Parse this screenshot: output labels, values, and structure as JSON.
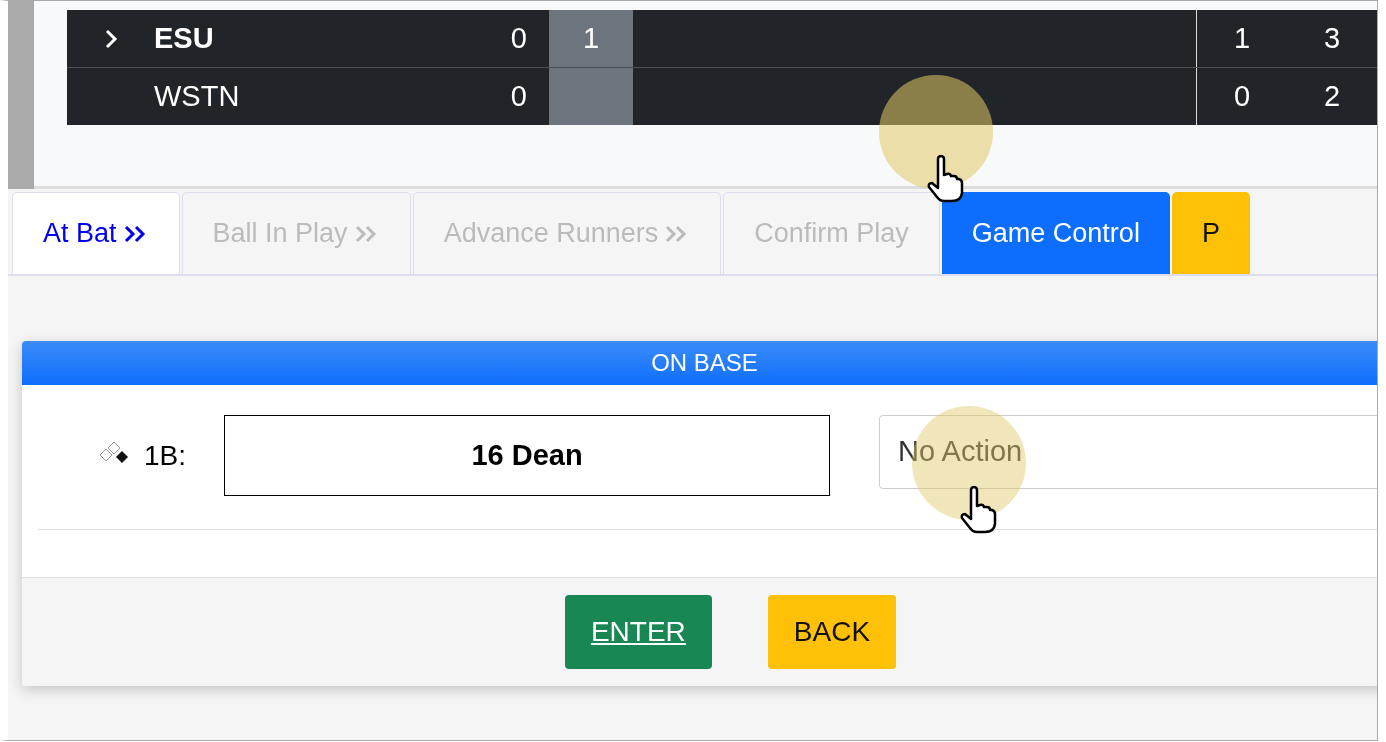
{
  "scoreboard": {
    "innings": [
      {
        "selected": false
      },
      {
        "selected": true
      }
    ],
    "rows": [
      {
        "team": "ESU",
        "at_bat": true,
        "scores": [
          "0",
          "1"
        ],
        "runs": "1",
        "hits": "3"
      },
      {
        "team": "WSTN",
        "at_bat": false,
        "scores": [
          "0"
        ],
        "runs": "0",
        "hits": "2"
      }
    ]
  },
  "tabs": [
    {
      "label": "At Bat",
      "kind": "step",
      "selected": true,
      "chevron": true
    },
    {
      "label": "Ball In Play",
      "kind": "step",
      "selected": false,
      "chevron": true
    },
    {
      "label": "Advance Runners",
      "kind": "step",
      "selected": false,
      "chevron": true
    },
    {
      "label": "Confirm Play",
      "kind": "step",
      "selected": false,
      "chevron": false
    },
    {
      "label": "Game Control",
      "kind": "button",
      "color": "#0d6efd"
    },
    {
      "label": "P",
      "kind": "button",
      "color": "#ffc107"
    }
  ],
  "on_base": {
    "title": "ON BASE",
    "runners": [
      {
        "base": "1B:",
        "player": "16 Dean",
        "action": "No Action"
      }
    ]
  },
  "buttons": [
    {
      "label": "ENTER",
      "color": "#198754"
    },
    {
      "label": "BACK",
      "color": "#ffc107"
    }
  ]
}
